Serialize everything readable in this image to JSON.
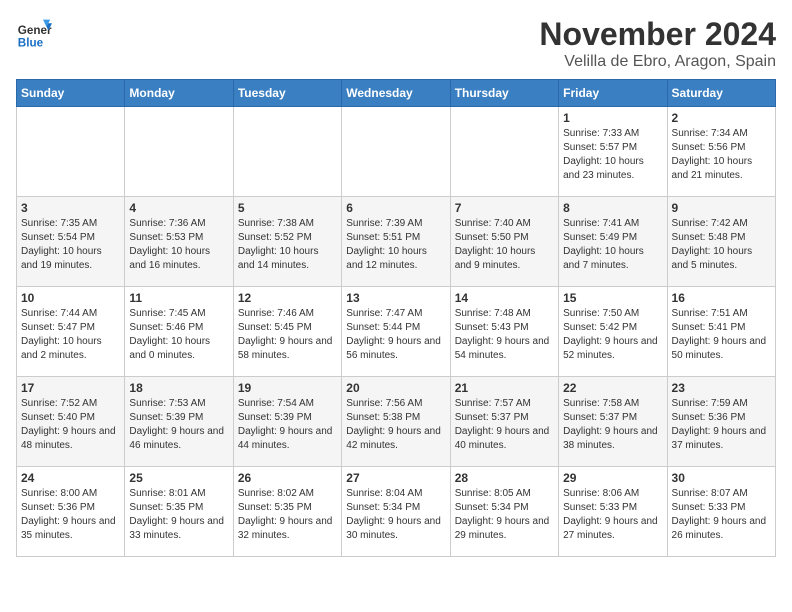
{
  "logo": {
    "line1": "General",
    "line2": "Blue"
  },
  "title": "November 2024",
  "location": "Velilla de Ebro, Aragon, Spain",
  "days_header": [
    "Sunday",
    "Monday",
    "Tuesday",
    "Wednesday",
    "Thursday",
    "Friday",
    "Saturday"
  ],
  "weeks": [
    [
      {
        "day": "",
        "info": ""
      },
      {
        "day": "",
        "info": ""
      },
      {
        "day": "",
        "info": ""
      },
      {
        "day": "",
        "info": ""
      },
      {
        "day": "",
        "info": ""
      },
      {
        "day": "1",
        "info": "Sunrise: 7:33 AM\nSunset: 5:57 PM\nDaylight: 10 hours and 23 minutes."
      },
      {
        "day": "2",
        "info": "Sunrise: 7:34 AM\nSunset: 5:56 PM\nDaylight: 10 hours and 21 minutes."
      }
    ],
    [
      {
        "day": "3",
        "info": "Sunrise: 7:35 AM\nSunset: 5:54 PM\nDaylight: 10 hours and 19 minutes."
      },
      {
        "day": "4",
        "info": "Sunrise: 7:36 AM\nSunset: 5:53 PM\nDaylight: 10 hours and 16 minutes."
      },
      {
        "day": "5",
        "info": "Sunrise: 7:38 AM\nSunset: 5:52 PM\nDaylight: 10 hours and 14 minutes."
      },
      {
        "day": "6",
        "info": "Sunrise: 7:39 AM\nSunset: 5:51 PM\nDaylight: 10 hours and 12 minutes."
      },
      {
        "day": "7",
        "info": "Sunrise: 7:40 AM\nSunset: 5:50 PM\nDaylight: 10 hours and 9 minutes."
      },
      {
        "day": "8",
        "info": "Sunrise: 7:41 AM\nSunset: 5:49 PM\nDaylight: 10 hours and 7 minutes."
      },
      {
        "day": "9",
        "info": "Sunrise: 7:42 AM\nSunset: 5:48 PM\nDaylight: 10 hours and 5 minutes."
      }
    ],
    [
      {
        "day": "10",
        "info": "Sunrise: 7:44 AM\nSunset: 5:47 PM\nDaylight: 10 hours and 2 minutes."
      },
      {
        "day": "11",
        "info": "Sunrise: 7:45 AM\nSunset: 5:46 PM\nDaylight: 10 hours and 0 minutes."
      },
      {
        "day": "12",
        "info": "Sunrise: 7:46 AM\nSunset: 5:45 PM\nDaylight: 9 hours and 58 minutes."
      },
      {
        "day": "13",
        "info": "Sunrise: 7:47 AM\nSunset: 5:44 PM\nDaylight: 9 hours and 56 minutes."
      },
      {
        "day": "14",
        "info": "Sunrise: 7:48 AM\nSunset: 5:43 PM\nDaylight: 9 hours and 54 minutes."
      },
      {
        "day": "15",
        "info": "Sunrise: 7:50 AM\nSunset: 5:42 PM\nDaylight: 9 hours and 52 minutes."
      },
      {
        "day": "16",
        "info": "Sunrise: 7:51 AM\nSunset: 5:41 PM\nDaylight: 9 hours and 50 minutes."
      }
    ],
    [
      {
        "day": "17",
        "info": "Sunrise: 7:52 AM\nSunset: 5:40 PM\nDaylight: 9 hours and 48 minutes."
      },
      {
        "day": "18",
        "info": "Sunrise: 7:53 AM\nSunset: 5:39 PM\nDaylight: 9 hours and 46 minutes."
      },
      {
        "day": "19",
        "info": "Sunrise: 7:54 AM\nSunset: 5:39 PM\nDaylight: 9 hours and 44 minutes."
      },
      {
        "day": "20",
        "info": "Sunrise: 7:56 AM\nSunset: 5:38 PM\nDaylight: 9 hours and 42 minutes."
      },
      {
        "day": "21",
        "info": "Sunrise: 7:57 AM\nSunset: 5:37 PM\nDaylight: 9 hours and 40 minutes."
      },
      {
        "day": "22",
        "info": "Sunrise: 7:58 AM\nSunset: 5:37 PM\nDaylight: 9 hours and 38 minutes."
      },
      {
        "day": "23",
        "info": "Sunrise: 7:59 AM\nSunset: 5:36 PM\nDaylight: 9 hours and 37 minutes."
      }
    ],
    [
      {
        "day": "24",
        "info": "Sunrise: 8:00 AM\nSunset: 5:36 PM\nDaylight: 9 hours and 35 minutes."
      },
      {
        "day": "25",
        "info": "Sunrise: 8:01 AM\nSunset: 5:35 PM\nDaylight: 9 hours and 33 minutes."
      },
      {
        "day": "26",
        "info": "Sunrise: 8:02 AM\nSunset: 5:35 PM\nDaylight: 9 hours and 32 minutes."
      },
      {
        "day": "27",
        "info": "Sunrise: 8:04 AM\nSunset: 5:34 PM\nDaylight: 9 hours and 30 minutes."
      },
      {
        "day": "28",
        "info": "Sunrise: 8:05 AM\nSunset: 5:34 PM\nDaylight: 9 hours and 29 minutes."
      },
      {
        "day": "29",
        "info": "Sunrise: 8:06 AM\nSunset: 5:33 PM\nDaylight: 9 hours and 27 minutes."
      },
      {
        "day": "30",
        "info": "Sunrise: 8:07 AM\nSunset: 5:33 PM\nDaylight: 9 hours and 26 minutes."
      }
    ]
  ]
}
